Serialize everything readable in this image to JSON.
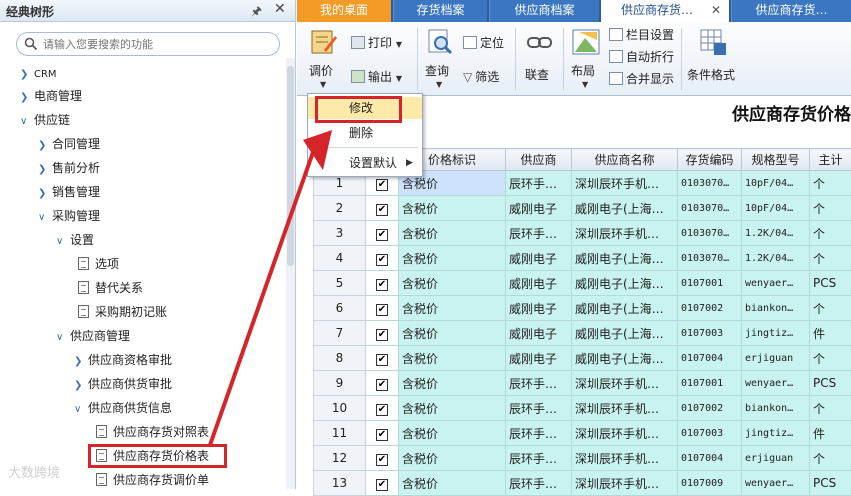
{
  "left_panel": {
    "title": "经典树形",
    "search_placeholder": "请输入您要搜索的功能",
    "tree": [
      {
        "label": "CRM"
      },
      {
        "label": "电商管理"
      },
      {
        "label": "供应链"
      },
      {
        "label": "合同管理"
      },
      {
        "label": "售前分析"
      },
      {
        "label": "销售管理"
      },
      {
        "label": "采购管理"
      },
      {
        "label": "设置"
      },
      {
        "label": "选项"
      },
      {
        "label": "替代关系"
      },
      {
        "label": "采购期初记账"
      },
      {
        "label": "供应商管理"
      },
      {
        "label": "供应商资格审批"
      },
      {
        "label": "供应商供货审批"
      },
      {
        "label": "供应商供货信息"
      },
      {
        "label": "供应商存货对照表"
      },
      {
        "label": "供应商存货价格表"
      },
      {
        "label": "供应商存货调价单"
      }
    ],
    "watermark": "大数跨境"
  },
  "tabs": [
    {
      "label": "我的桌面"
    },
    {
      "label": "存货档案"
    },
    {
      "label": "供应商档案"
    },
    {
      "label": "供应商存货…"
    },
    {
      "label": "供应商存货…"
    }
  ],
  "ribbon": {
    "adjust_price": "调价",
    "print": "打印",
    "output": "输出",
    "query": "查询",
    "locate": "定位",
    "filter": "筛选",
    "link_query": "联查",
    "layout": "布局",
    "column_settings": "栏目设置",
    "auto_wrap": "自动折行",
    "merge_display": "合并显示",
    "conditional_format": "条件格式"
  },
  "context_menu": {
    "modify": "修改",
    "delete": "删除",
    "set_default": "设置默认"
  },
  "grid": {
    "title": "供应商存货价格",
    "columns": [
      "",
      "价格标识",
      "供应商",
      "供应商名称",
      "存货编码",
      "规格型号",
      "主计"
    ],
    "rows": [
      {
        "num": "1",
        "flag": "含税价",
        "vendor": "辰环手…",
        "vname": "深圳辰环手机…",
        "code": "0103070…",
        "spec": "10pF/04…",
        "unit": "个"
      },
      {
        "num": "2",
        "flag": "含税价",
        "vendor": "威刚电子",
        "vname": "威刚电子(上海…",
        "code": "0103070…",
        "spec": "10pF/04…",
        "unit": "个"
      },
      {
        "num": "3",
        "flag": "含税价",
        "vendor": "辰环手…",
        "vname": "深圳辰环手机…",
        "code": "0103070…",
        "spec": "1.2K/04…",
        "unit": "个"
      },
      {
        "num": "4",
        "flag": "含税价",
        "vendor": "威刚电子",
        "vname": "威刚电子(上海…",
        "code": "0103070…",
        "spec": "1.2K/04…",
        "unit": "个"
      },
      {
        "num": "5",
        "flag": "含税价",
        "vendor": "威刚电子",
        "vname": "威刚电子(上海…",
        "code": "0107001",
        "spec": "wenyaer…",
        "unit": "PCS"
      },
      {
        "num": "6",
        "flag": "含税价",
        "vendor": "威刚电子",
        "vname": "威刚电子(上海…",
        "code": "0107002",
        "spec": "biankon…",
        "unit": "个"
      },
      {
        "num": "7",
        "flag": "含税价",
        "vendor": "威刚电子",
        "vname": "威刚电子(上海…",
        "code": "0107003",
        "spec": "jingtiz…",
        "unit": "件"
      },
      {
        "num": "8",
        "flag": "含税价",
        "vendor": "威刚电子",
        "vname": "威刚电子(上海…",
        "code": "0107004",
        "spec": "erjiguan",
        "unit": "个"
      },
      {
        "num": "9",
        "flag": "含税价",
        "vendor": "辰环手…",
        "vname": "深圳辰环手机…",
        "code": "0107001",
        "spec": "wenyaer…",
        "unit": "PCS"
      },
      {
        "num": "10",
        "flag": "含税价",
        "vendor": "辰环手…",
        "vname": "深圳辰环手机…",
        "code": "0107002",
        "spec": "biankon…",
        "unit": "个"
      },
      {
        "num": "11",
        "flag": "含税价",
        "vendor": "辰环手…",
        "vname": "深圳辰环手机…",
        "code": "0107003",
        "spec": "jingtiz…",
        "unit": "件"
      },
      {
        "num": "12",
        "flag": "含税价",
        "vendor": "辰环手…",
        "vname": "深圳辰环手机…",
        "code": "0107004",
        "spec": "erjiguan",
        "unit": "个"
      },
      {
        "num": "13",
        "flag": "含税价",
        "vendor": "辰环手…",
        "vname": "深圳辰环手机…",
        "code": "0107009",
        "spec": "wenyaer…",
        "unit": "PCS"
      }
    ]
  },
  "colors": {
    "tab_bar": "#2a5ea1",
    "tab_orange": "#f39a27",
    "row_cyan": "#c9f3ee",
    "annotation_red": "#d6252a"
  }
}
